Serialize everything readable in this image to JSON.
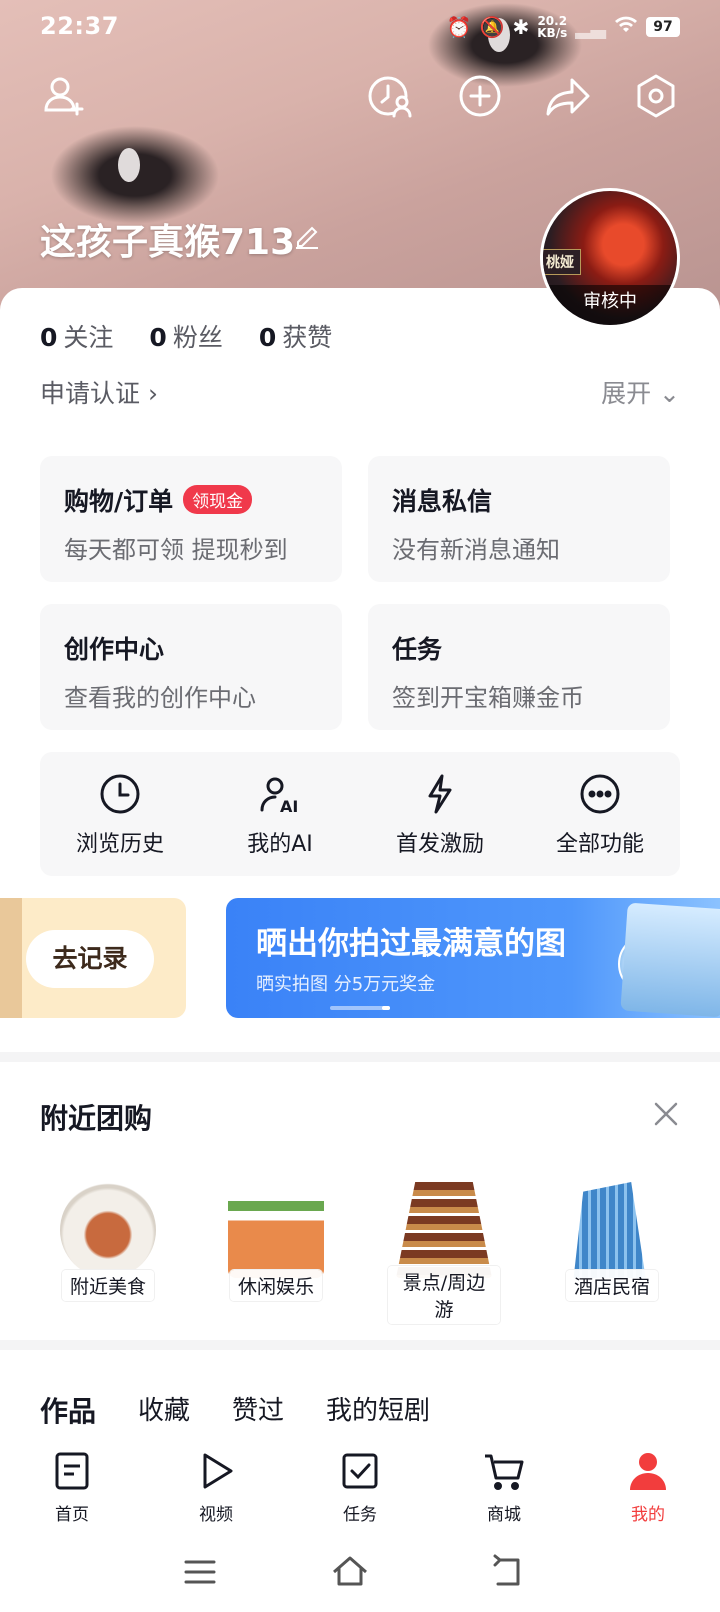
{
  "status_bar": {
    "time": "22:37",
    "net_speed_value": "20.2",
    "net_speed_unit": "KB/s",
    "battery": "97"
  },
  "profile": {
    "username": "这孩子真猴713",
    "avatar_status": "审核中",
    "avatar_game_tag": "桃娅"
  },
  "stats": [
    {
      "count": "0",
      "label": "关注"
    },
    {
      "count": "0",
      "label": "粉丝"
    },
    {
      "count": "0",
      "label": "获赞"
    }
  ],
  "apply_verification": "申请认证 ›",
  "expand": "展开 ⌄",
  "tiles": [
    {
      "title": "购物/订单",
      "badge": "领现金",
      "subtitle": "每天都可领 提现秒到"
    },
    {
      "title": "消息私信",
      "subtitle": "没有新消息通知"
    },
    {
      "title": "创作中心",
      "subtitle": "查看我的创作中心"
    },
    {
      "title": "任务",
      "subtitle": "签到开宝箱赚金币"
    }
  ],
  "quick_actions": [
    {
      "label": "浏览历史",
      "icon": "clock-icon"
    },
    {
      "label": "我的AI",
      "icon": "ai-person-icon"
    },
    {
      "label": "首发激励",
      "icon": "lightning-icon"
    },
    {
      "label": "全部功能",
      "icon": "more-dots-icon"
    }
  ],
  "banners": {
    "left_button": "去记录",
    "main_title": "晒出你拍过最满意的图",
    "main_subtitle": "晒实拍图   分5万元奖金"
  },
  "nearby": {
    "title": "附近团购",
    "categories": [
      {
        "label": "附近美食"
      },
      {
        "label": "休闲娱乐"
      },
      {
        "label": "景点/周边游"
      },
      {
        "label": "酒店民宿"
      }
    ]
  },
  "content_tabs": [
    "作品",
    "收藏",
    "赞过",
    "我的短剧"
  ],
  "bottom_nav": [
    {
      "label": "首页",
      "icon": "home-doc-icon"
    },
    {
      "label": "视频",
      "icon": "play-icon"
    },
    {
      "label": "任务",
      "icon": "checkbox-icon"
    },
    {
      "label": "商城",
      "icon": "cart-icon"
    },
    {
      "label": "我的",
      "icon": "person-icon",
      "active": true
    }
  ],
  "colors": {
    "accent_red": "#f23d3d",
    "banner_blue": "#3a82f7",
    "tile_bg": "#f7f7f8"
  }
}
